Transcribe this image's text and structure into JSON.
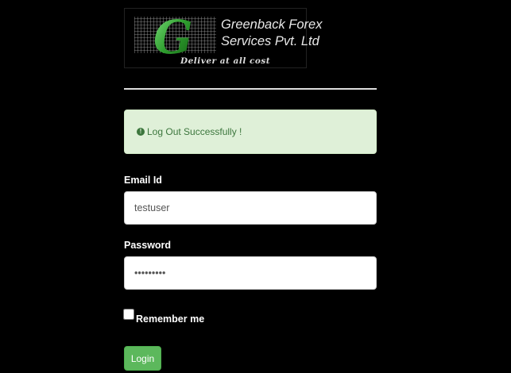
{
  "logo": {
    "letter": "G",
    "name_line1": "Greenback Forex",
    "name_line2": "Services Pvt. Ltd",
    "tagline": "Deliver at all cost"
  },
  "alert": {
    "icon": "exclamation-circle-icon",
    "message": "Log Out Successfully !"
  },
  "form": {
    "email_label": "Email Id",
    "email_value": "testuser",
    "password_label": "Password",
    "password_value": "•••••••••",
    "remember_label": "Remember me",
    "login_label": "Login"
  },
  "colors": {
    "background": "#000000",
    "logo_green": "#3aa83a",
    "alert_bg": "#dff0d8",
    "alert_text": "#3c763d",
    "button": "#5cb85c"
  }
}
